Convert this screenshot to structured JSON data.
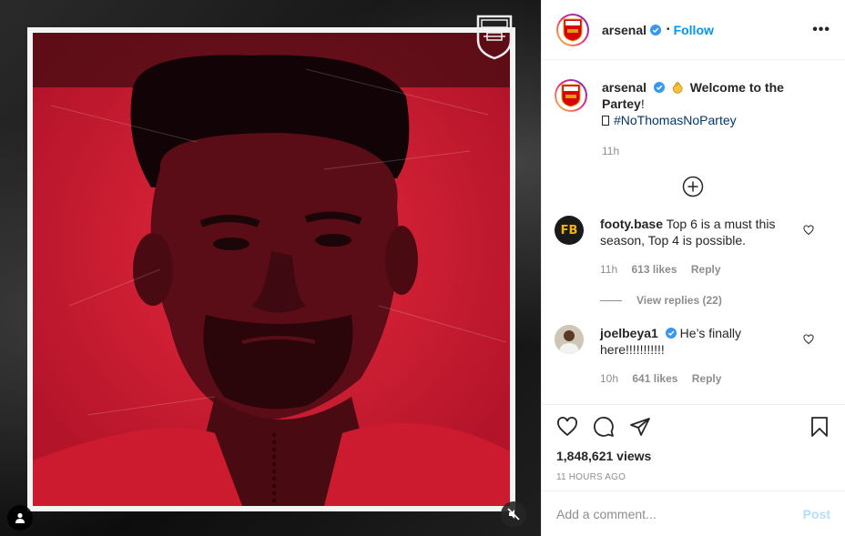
{
  "post": {
    "username": "arsenal",
    "follow_label": "Follow",
    "separator": "•",
    "more_label": "•••"
  },
  "caption": {
    "username": "arsenal",
    "text": "Welcome to the Partey",
    "punct": "!",
    "hashtag": "#NoThomasNoPartey",
    "time": "11h"
  },
  "comments": [
    {
      "username": "footy.base",
      "text": "Top 6 is a must this season, Top 4 is possible.",
      "time": "11h",
      "likes": "613 likes",
      "reply_label": "Reply",
      "avatar_text": "FB",
      "view_replies": "View replies (22)"
    },
    {
      "username": "joelbeya1",
      "text": "He’s finally here!!!!!!!!!!!",
      "time": "10h",
      "likes": "641 likes",
      "reply_label": "Reply"
    }
  ],
  "stats": {
    "views": "1,848,621 views",
    "posted_ago": "11 HOURS AGO"
  },
  "composer": {
    "placeholder": "Add a comment...",
    "post_label": "Post"
  },
  "colors": {
    "accent": "#0095f6",
    "arsenal_red": "#db0007",
    "post_disabled": "#b2dffc"
  },
  "icons": [
    "arsenal-crest-icon",
    "verified-badge-icon",
    "more-options-icon",
    "clapping-hands-icon",
    "add-circle-icon",
    "heart-icon",
    "comment-icon",
    "share-icon",
    "bookmark-icon",
    "user-tag-icon",
    "sound-off-icon"
  ]
}
